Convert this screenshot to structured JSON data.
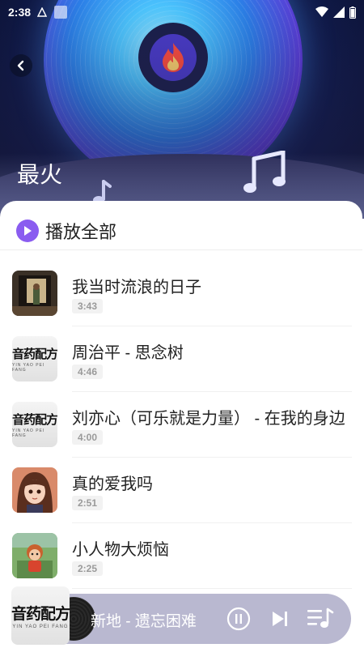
{
  "status_bar": {
    "time": "2:38"
  },
  "page": {
    "title": "最火"
  },
  "list": {
    "play_all_label": "播放全部",
    "songs": [
      {
        "title": "我当时流浪的日子",
        "duration": "3:43",
        "cover": "photo-dark"
      },
      {
        "title": "周治平 - 思念树",
        "duration": "4:46",
        "cover": "brand"
      },
      {
        "title": "刘亦心（可乐就是力量） - 在我的身边",
        "duration": "4:00",
        "cover": "brand"
      },
      {
        "title": "真的爱我吗",
        "duration": "2:51",
        "cover": "anime-girl"
      },
      {
        "title": "小人物大烦恼",
        "duration": "2:25",
        "cover": "cartoon"
      }
    ]
  },
  "brand_cover": {
    "text": "音药配方",
    "subtext": "YIN YAO PEI FANG"
  },
  "player": {
    "now_playing": "新地 - 遗忘困难"
  },
  "colors": {
    "accent": "#8a5cf0",
    "player_bar": "#b9b8d0"
  }
}
